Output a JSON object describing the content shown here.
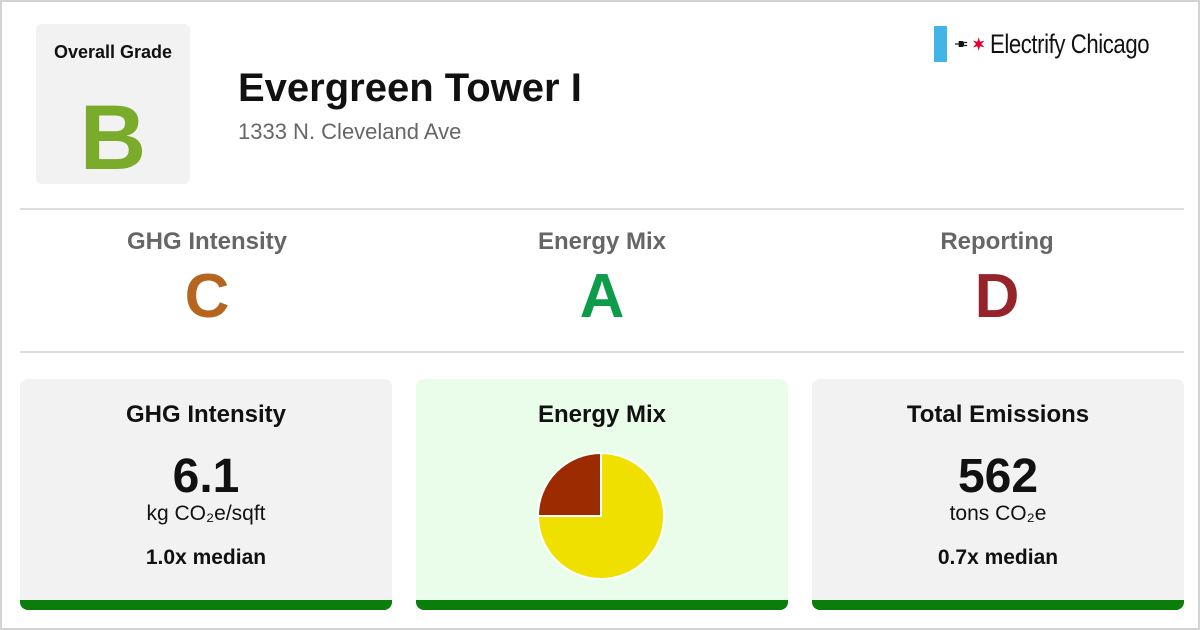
{
  "overall": {
    "title": "Overall Grade",
    "grade": "B",
    "color": "#7bab2b"
  },
  "building": {
    "name": "Evergreen Tower I",
    "address": "1333 N. Cleveland Ave"
  },
  "brand": {
    "name": "Electrify Chicago",
    "flag_color": "#41b6e6",
    "star_color": "#e4002b",
    "icons": [
      "plug-icon",
      "star-icon"
    ]
  },
  "subgrades": [
    {
      "label": "GHG Intensity",
      "grade": "C",
      "color": "#b5651d"
    },
    {
      "label": "Energy Mix",
      "grade": "A",
      "color": "#0e9c4a"
    },
    {
      "label": "Reporting",
      "grade": "D",
      "color": "#96232a"
    }
  ],
  "cards": {
    "ghg": {
      "title": "GHG Intensity",
      "value": "6.1",
      "unit": "kg CO₂e/sqft",
      "median": "1.0x median"
    },
    "mix": {
      "title": "Energy Mix"
    },
    "emissions": {
      "title": "Total Emissions",
      "value": "562",
      "unit": "tons CO₂e",
      "median": "0.7x median"
    },
    "bar_color": "#0a7d0a",
    "mix_background": "#eafcea"
  },
  "chart_data": {
    "type": "pie",
    "slices": [
      {
        "value": 75,
        "color": "#f0e000"
      },
      {
        "value": 25,
        "color": "#9c2c00"
      }
    ]
  }
}
